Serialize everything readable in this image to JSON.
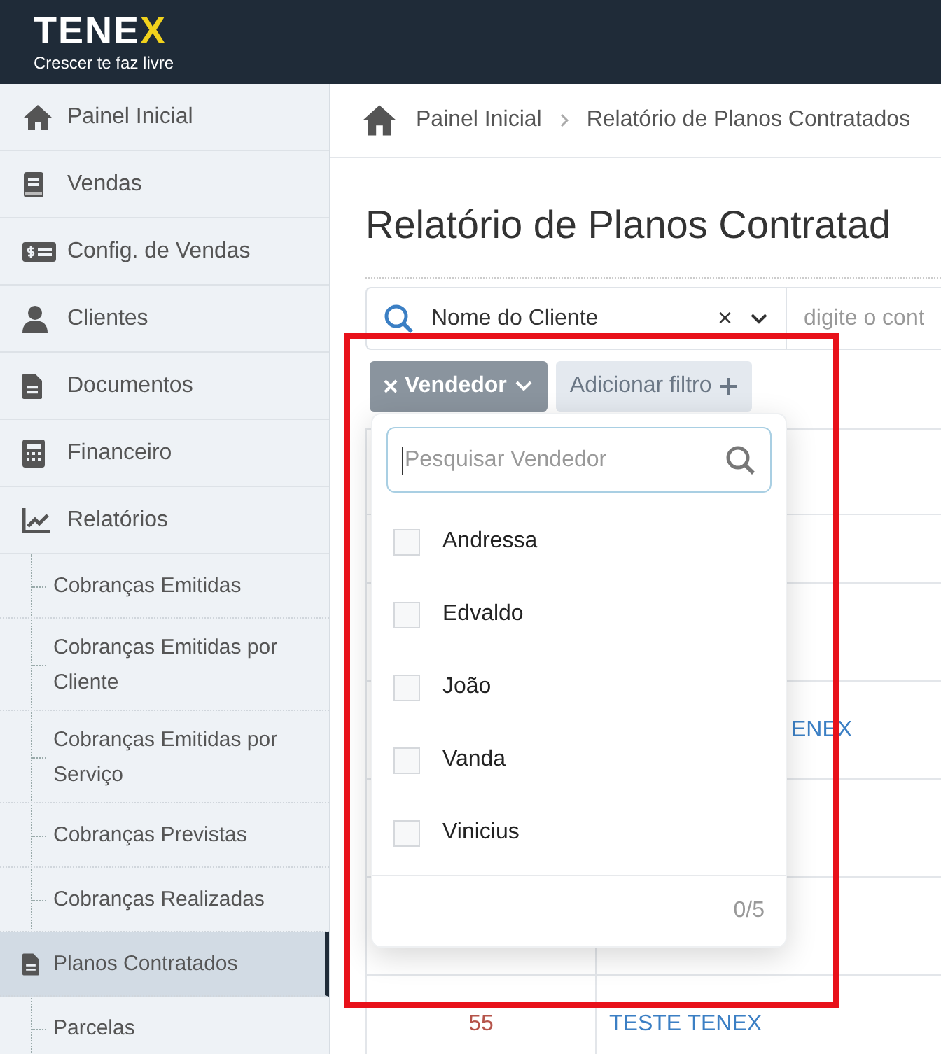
{
  "logo": {
    "text": "TENE",
    "accent": "X",
    "tagline": "Crescer te faz livre"
  },
  "sidebar": {
    "items": [
      {
        "label": "Painel Inicial",
        "selected": false
      },
      {
        "label": "Vendas",
        "selected": false
      },
      {
        "label": "Config. de Vendas",
        "selected": false
      },
      {
        "label": "Clientes",
        "selected": false
      },
      {
        "label": "Documentos",
        "selected": false
      },
      {
        "label": "Financeiro",
        "selected": false
      },
      {
        "label": "Relatórios",
        "selected": false,
        "children": [
          {
            "label": "Cobranças Emitidas",
            "selected": false
          },
          {
            "label": "Cobranças Emitidas por Cliente",
            "selected": false
          },
          {
            "label": "Cobranças Emitidas por Serviço",
            "selected": false
          },
          {
            "label": "Cobranças Previstas",
            "selected": false
          },
          {
            "label": "Cobranças Realizadas",
            "selected": false
          },
          {
            "label": "Planos Contratados",
            "selected": true
          },
          {
            "label": "Parcelas",
            "selected": false
          }
        ]
      }
    ]
  },
  "breadcrumb": [
    "Painel Inicial",
    "Relatório de Planos Contratados"
  ],
  "title": "Relatório de Planos Contratad",
  "filter_bar": {
    "field": "Nome do Cliente",
    "clear": "×",
    "placeholder": "digite o cont"
  },
  "filters": [
    {
      "label": "Vendedor",
      "kind": "active"
    },
    {
      "label": "Adicionar filtro",
      "kind": "add"
    }
  ],
  "dropdown": {
    "placeholder": "Pesquisar Vendedor",
    "options": [
      {
        "label": "Andressa",
        "checked": false
      },
      {
        "label": "Edvaldo",
        "checked": false
      },
      {
        "label": "João",
        "checked": false
      },
      {
        "label": "Vanda",
        "checked": false
      },
      {
        "label": "Vinicius",
        "checked": false
      }
    ],
    "count": "0/5"
  },
  "table": {
    "rows": [
      {
        "kind": "partly_covered",
        "column_2": "ENEX"
      },
      {
        "kind": "plain",
        "column_1": "55",
        "column_2": "TESTE TENEX"
      }
    ]
  }
}
